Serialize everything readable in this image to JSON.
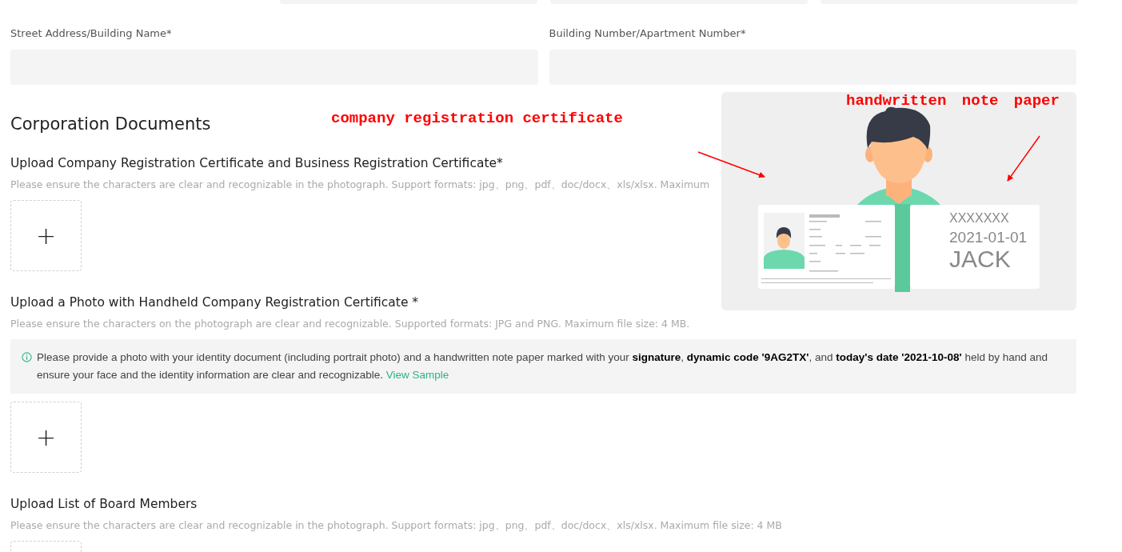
{
  "address_fields": [
    {
      "label": "Street Address/Building Name*"
    },
    {
      "label": "Building Number/Apartment Number*"
    }
  ],
  "section_title": "Corporation Documents",
  "uploads": [
    {
      "title": "Upload Company Registration Certificate and Business Registration Certificate*",
      "hint": "Please ensure the characters are clear and recognizable in the photograph. Support formats: jpg、png、pdf、doc/docx、xls/xlsx. Maximum",
      "button": "+"
    },
    {
      "title": "Upload a Photo with Handheld Company Registration Certificate *",
      "hint": "Please ensure the characters on the photograph are clear and recognizable. Supported formats: JPG and PNG. Maximum file size: 4 MB.",
      "notice": {
        "text": "Please provide a photo with your identity document (including portrait photo) and a handwritten note paper marked with your **signature**, **dynamic code '9AG2TX'**, and **today's date '2021-10-08'** held by hand and ensure your face and the identity information are clear and recognizable.",
        "link": "View Sample"
      },
      "button": "+"
    },
    {
      "title": "Upload List of Board Members",
      "hint": "Please ensure the characters are clear and recognizable in the photograph. Support formats: jpg、png、pdf、doc/docx、xls/xlsx. Maximum file size: 4 MB"
    }
  ],
  "sample": {
    "note_lines": [
      "XXXXXXX",
      "2021-01-01",
      "JACK"
    ]
  },
  "annotations": [
    {
      "text": "company registration certificate",
      "kind": "certificate"
    },
    {
      "text": "handwritten note paper",
      "kind": "note"
    }
  ]
}
